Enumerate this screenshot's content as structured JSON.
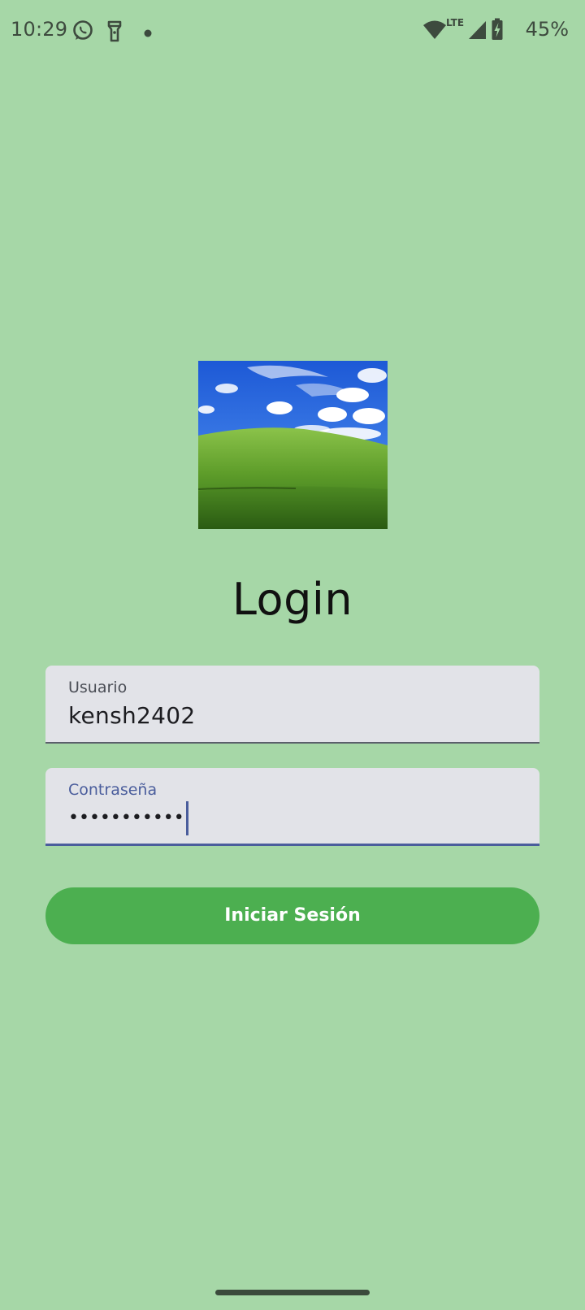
{
  "status_bar": {
    "time": "10:29",
    "left_icons": [
      "whatsapp-icon",
      "flashlight-icon",
      "notification-dot-icon"
    ],
    "right_icons": [
      "wifi-icon",
      "lte-icon",
      "cell-signal-icon",
      "battery-charging-icon"
    ],
    "network_label": "LTE",
    "battery_percent": "45%"
  },
  "login": {
    "logo": "landscape-image",
    "title": "Login",
    "username": {
      "label": "Usuario",
      "value": "kensh2402"
    },
    "password": {
      "label": "Contraseña",
      "masked_value": "•••••••••••"
    },
    "submit_label": "Iniciar Sesión"
  },
  "colors": {
    "background": "#a6d7a7",
    "field_background": "#e2e3e8",
    "focus_accent": "#4a5d9c",
    "button": "#4caf50",
    "button_text": "#ffffff"
  }
}
